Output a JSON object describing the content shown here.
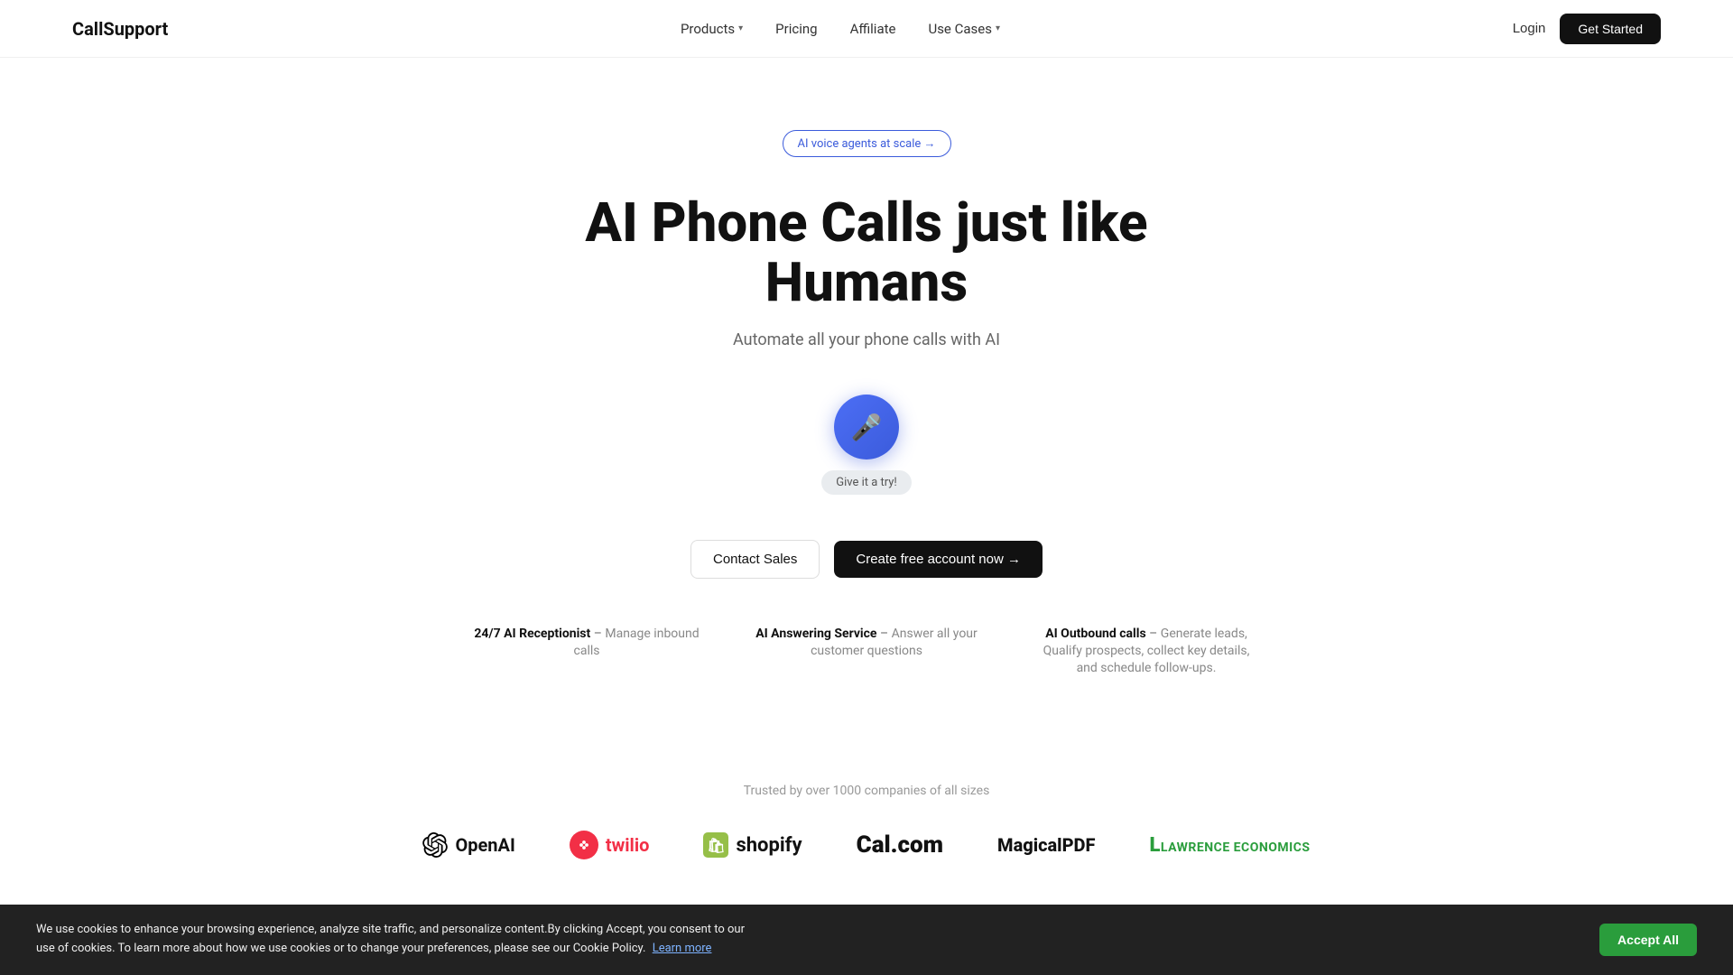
{
  "brand": {
    "name": "CallSupport"
  },
  "nav": {
    "links": [
      {
        "id": "products",
        "label": "Products",
        "hasDropdown": true
      },
      {
        "id": "pricing",
        "label": "Pricing",
        "hasDropdown": false
      },
      {
        "id": "affiliate",
        "label": "Affiliate",
        "hasDropdown": false
      },
      {
        "id": "use-cases",
        "label": "Use Cases",
        "hasDropdown": true
      }
    ],
    "login_label": "Login",
    "get_started_label": "Get Started"
  },
  "hero": {
    "badge_label": "AI voice agents at scale →",
    "title": "AI Phone Calls just like Humans",
    "subtitle": "Automate all your phone calls with AI",
    "mic_label": "Give it a try!",
    "cta_contact_sales": "Contact Sales",
    "cta_create_account": "Create free account now →"
  },
  "features": [
    {
      "title": "24/7 AI Receptionist",
      "desc": "Manage inbound calls"
    },
    {
      "title": "AI Answering Service",
      "desc": "Answer all your customer questions"
    },
    {
      "title": "AI Outbound calls",
      "desc": "Generate leads, Qualify prospects, collect key details, and schedule follow-ups."
    }
  ],
  "trusted": {
    "label": "Trusted by over 1000 companies of all sizes",
    "logos": [
      {
        "id": "openai",
        "name": "OpenAI"
      },
      {
        "id": "twilio",
        "name": "twilio"
      },
      {
        "id": "shopify",
        "name": "shopify"
      },
      {
        "id": "calcom",
        "name": "Cal.com"
      },
      {
        "id": "magicalpdf",
        "name": "MagicalPDF"
      },
      {
        "id": "lawrence",
        "name": "LAWRENCE ECONOMICS"
      }
    ]
  },
  "cookie": {
    "message": "We use cookies to enhance your browsing experience, analyze site traffic, and personalize content.By clicking Accept, you consent to our use of cookies. To learn more about how we use cookies or to change your preferences, please see our Cookie Policy.",
    "learn_more": "Learn more",
    "accept_label": "Accept All"
  }
}
